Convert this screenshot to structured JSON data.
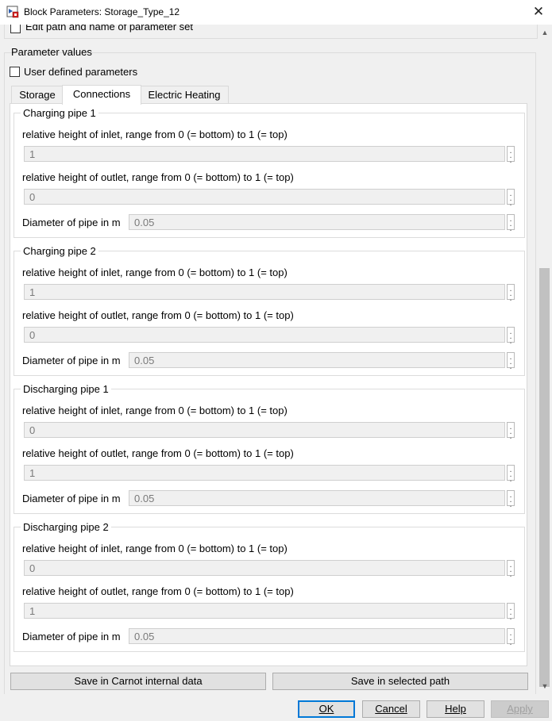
{
  "window": {
    "title": "Block Parameters: Storage_Type_12",
    "close_glyph": "✕"
  },
  "top": {
    "edit_path_label": "Edit path and name of parameter set"
  },
  "parameter_values": {
    "legend": "Parameter values",
    "user_defined_label": "User defined parameters"
  },
  "tabs": [
    {
      "label": "Storage"
    },
    {
      "label": "Connections"
    },
    {
      "label": "Electric Heating"
    }
  ],
  "groups": [
    {
      "title": "Charging pipe 1",
      "inlet_label": "relative height of inlet, range from 0 (= bottom) to 1 (= top)",
      "inlet_value": "1",
      "outlet_label": "relative height of outlet, range from 0 (= bottom) to 1 (= top)",
      "outlet_value": "0",
      "diameter_label": "Diameter of pipe in m",
      "diameter_value": "0.05"
    },
    {
      "title": "Charging pipe 2",
      "inlet_label": "relative height of inlet, range from 0 (= bottom) to 1 (= top)",
      "inlet_value": "1",
      "outlet_label": "relative height of outlet, range from 0 (= bottom) to 1 (= top)",
      "outlet_value": "0",
      "diameter_label": "Diameter of pipe in m",
      "diameter_value": "0.05"
    },
    {
      "title": "Discharging pipe 1",
      "inlet_label": "relative height of inlet, range from 0 (= bottom) to 1 (= top)",
      "inlet_value": "0",
      "outlet_label": "relative height of outlet, range from 0 (= bottom) to 1 (= top)",
      "outlet_value": "1",
      "diameter_label": "Diameter of pipe in m",
      "diameter_value": "0.05"
    },
    {
      "title": "Discharging pipe 2",
      "inlet_label": "relative height of inlet, range from 0 (= bottom) to 1 (= top)",
      "inlet_value": "0",
      "outlet_label": "relative height of outlet, range from 0 (= bottom) to 1 (= top)",
      "outlet_value": "1",
      "diameter_label": "Diameter of pipe in m",
      "diameter_value": "0.05"
    }
  ],
  "save_buttons": {
    "internal": "Save in Carnot internal data",
    "selected": "Save in selected path"
  },
  "dialog_buttons": {
    "ok": "OK",
    "cancel": "Cancel",
    "help": "Help",
    "apply": "Apply"
  }
}
